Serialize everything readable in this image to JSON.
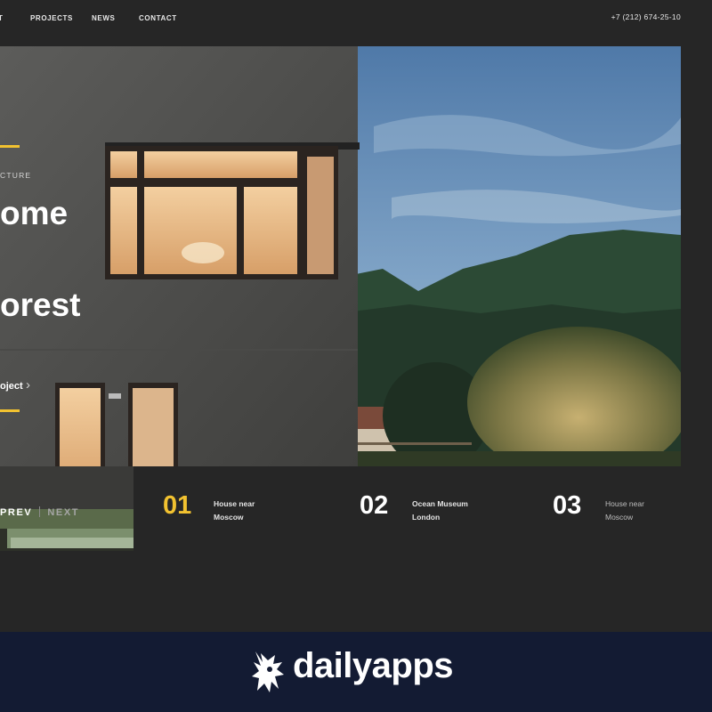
{
  "nav": {
    "items": [
      {
        "label": "T"
      },
      {
        "label": "PROJECTS"
      },
      {
        "label": "NEWS"
      },
      {
        "label": "CONTACT"
      }
    ],
    "phone": "+7 (212) 674-25-10"
  },
  "hero": {
    "category": "CTURE",
    "title_line_1": "ome",
    "title_line_2": "orest",
    "view_link": "oject",
    "accent_color": "#f2c230"
  },
  "pager": {
    "prev": "PREV",
    "next": "NEXT"
  },
  "projects": [
    {
      "number": "01",
      "label": "House near\nMoscow",
      "active": true
    },
    {
      "number": "02",
      "label": "Ocean Museum\nLondon",
      "active": false
    },
    {
      "number": "03",
      "label": "House near\nMoscow",
      "active": false
    }
  ],
  "brand": {
    "name": "dailyapps",
    "logo_icon": "unicorn-logo-icon",
    "bar_color": "#131b33"
  }
}
